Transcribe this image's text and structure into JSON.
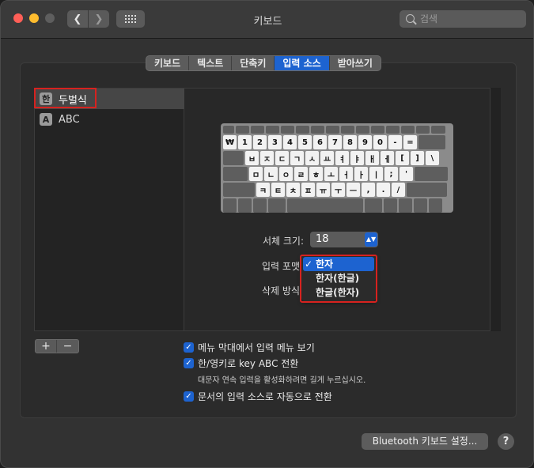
{
  "window": {
    "title": "키보드"
  },
  "search": {
    "placeholder": "검색"
  },
  "tabs": [
    {
      "label": "키보드"
    },
    {
      "label": "텍스트"
    },
    {
      "label": "단축키"
    },
    {
      "label": "입력 소스",
      "active": true
    },
    {
      "label": "받아쓰기"
    }
  ],
  "sources": [
    {
      "badge": "한",
      "label": "두벌식",
      "selected": true
    },
    {
      "badge": "A",
      "label": "ABC"
    }
  ],
  "keyboard": {
    "row1": [
      "₩",
      "1",
      "2",
      "3",
      "4",
      "5",
      "6",
      "7",
      "8",
      "9",
      "0",
      "-",
      "="
    ],
    "row2": [
      "ㅂ",
      "ㅈ",
      "ㄷ",
      "ㄱ",
      "ㅅ",
      "ㅛ",
      "ㅕ",
      "ㅑ",
      "ㅐ",
      "ㅔ",
      "[",
      "]",
      "\\"
    ],
    "row3": [
      "ㅁ",
      "ㄴ",
      "ㅇ",
      "ㄹ",
      "ㅎ",
      "ㅗ",
      "ㅓ",
      "ㅏ",
      "ㅣ",
      ";",
      "'"
    ],
    "row4": [
      "ㅋ",
      "ㅌ",
      "ㅊ",
      "ㅍ",
      "ㅠ",
      "ㅜ",
      "ㅡ",
      ",",
      ".",
      "/"
    ]
  },
  "font_size": {
    "label": "서체 크기:",
    "value": "18"
  },
  "input_format": {
    "label": "입력 포맷",
    "options": [
      "한자",
      "한자(한글)",
      "한글(한자)"
    ],
    "selected": "한자"
  },
  "delete_mode": {
    "label": "삭제 방식"
  },
  "buttons": {
    "add": "+",
    "remove": "−",
    "bluetooth": "Bluetooth 키보드 설정...",
    "help": "?"
  },
  "options": {
    "show_menu": "메뉴 막대에서 입력 메뉴 보기",
    "han_eng_key": "한/영키로 key ABC 전환",
    "han_eng_hint": "대문자 연속 입력을 활성화하려면 길게 누르십시오.",
    "auto_switch": "문서의 입력 소스로 자동으로 전환"
  },
  "colors": {
    "accent": "#1d63d0",
    "highlight_box": "#d7221f"
  }
}
